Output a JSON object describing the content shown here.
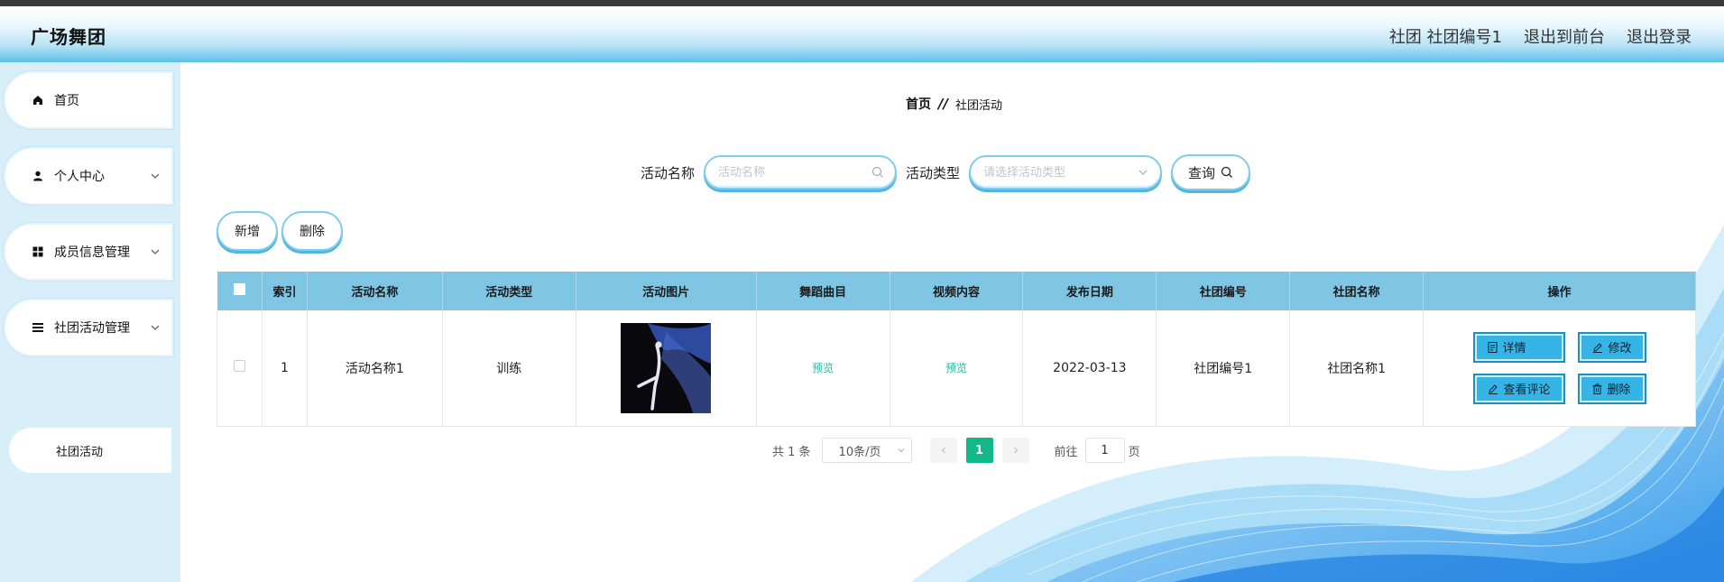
{
  "header": {
    "brand": "广场舞团",
    "user_label": "社团 社团编号1",
    "back_to_front": "退出到前台",
    "logout": "退出登录"
  },
  "sidebar": {
    "items": [
      {
        "label": "首页",
        "icon": "home-icon"
      },
      {
        "label": "个人中心",
        "icon": "user-icon"
      },
      {
        "label": "成员信息管理",
        "icon": "grid-icon"
      },
      {
        "label": "社团活动管理",
        "icon": "list-icon"
      }
    ],
    "sub_item": "社团活动"
  },
  "breadcrumb": {
    "home": "首页",
    "sep": "//",
    "current": "社团活动"
  },
  "search": {
    "name_label": "活动名称",
    "name_placeholder": "活动名称",
    "type_label": "活动类型",
    "type_placeholder": "请选择活动类型",
    "query_label": "查询"
  },
  "actions": {
    "add": "新增",
    "delete": "删除"
  },
  "table": {
    "headers": [
      "索引",
      "活动名称",
      "活动类型",
      "活动图片",
      "舞蹈曲目",
      "视频内容",
      "发布日期",
      "社团编号",
      "社团名称",
      "操作"
    ],
    "rows": [
      {
        "index": "1",
        "name": "活动名称1",
        "type": "训练",
        "music": "预览",
        "video": "预览",
        "date": "2022-03-13",
        "club_no": "社团编号1",
        "club_name": "社团名称1"
      }
    ],
    "ops": {
      "detail": "详情",
      "edit": "修改",
      "comments": "查看评论",
      "delete": "删除"
    }
  },
  "pager": {
    "total": "共 1 条",
    "size": "10条/页",
    "current": "1",
    "goto_label": "前往",
    "goto_value": "1",
    "page_suffix": "页"
  },
  "colors": {
    "header_blue": "#5cc0ea",
    "table_header": "#7fc6e5",
    "op_button": "#35b4e6",
    "pager_active": "#13b889",
    "sidebar_bg": "#d8eef9"
  }
}
